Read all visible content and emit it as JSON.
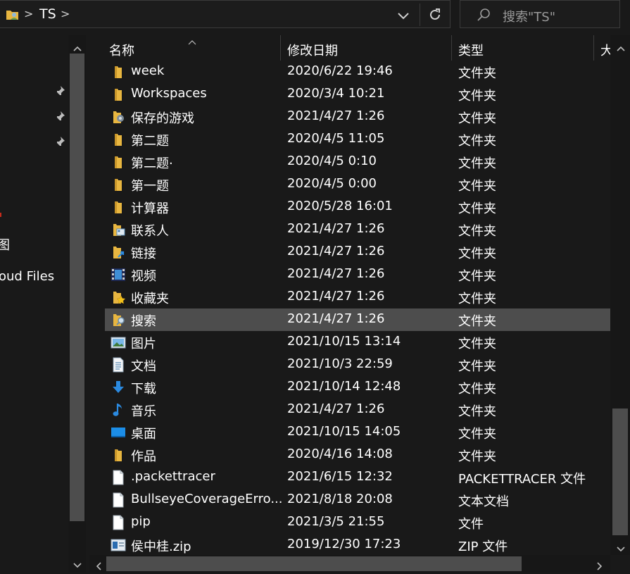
{
  "address": {
    "crumb": "TS",
    "separator": ">"
  },
  "search": {
    "placeholder": "搜索\"TS\""
  },
  "nav": {
    "items": [
      "图",
      "oud Files"
    ]
  },
  "columns": {
    "name": "名称",
    "date": "修改日期",
    "type": "类型",
    "size": "大"
  },
  "files": [
    {
      "name": "week",
      "date": "2020/6/22 19:46",
      "type": "文件夹",
      "icon": "folder-icon"
    },
    {
      "name": "Workspaces",
      "date": "2020/3/4 10:21",
      "type": "文件夹",
      "icon": "folder-icon"
    },
    {
      "name": "保存的游戏",
      "date": "2021/4/27 1:26",
      "type": "文件夹",
      "icon": "saved-games-icon"
    },
    {
      "name": "第二题",
      "date": "2020/4/5 11:05",
      "type": "文件夹",
      "icon": "folder-icon"
    },
    {
      "name": "第二题·",
      "date": "2020/4/5 0:10",
      "type": "文件夹",
      "icon": "folder-icon"
    },
    {
      "name": "第一题",
      "date": "2020/4/5 0:00",
      "type": "文件夹",
      "icon": "folder-icon"
    },
    {
      "name": "计算器",
      "date": "2020/5/28 16:01",
      "type": "文件夹",
      "icon": "folder-icon"
    },
    {
      "name": "联系人",
      "date": "2021/4/27 1:26",
      "type": "文件夹",
      "icon": "contacts-icon"
    },
    {
      "name": "链接",
      "date": "2021/4/27 1:26",
      "type": "文件夹",
      "icon": "links-icon"
    },
    {
      "name": "视频",
      "date": "2021/4/27 1:26",
      "type": "文件夹",
      "icon": "videos-icon"
    },
    {
      "name": "收藏夹",
      "date": "2021/4/27 1:26",
      "type": "文件夹",
      "icon": "favorites-icon"
    },
    {
      "name": "搜索",
      "date": "2021/4/27 1:26",
      "type": "文件夹",
      "icon": "searches-icon"
    },
    {
      "name": "图片",
      "date": "2021/10/15 13:14",
      "type": "文件夹",
      "icon": "pictures-icon"
    },
    {
      "name": "文档",
      "date": "2021/10/3 22:59",
      "type": "文件夹",
      "icon": "documents-icon"
    },
    {
      "name": "下载",
      "date": "2021/10/14 12:48",
      "type": "文件夹",
      "icon": "downloads-icon"
    },
    {
      "name": "音乐",
      "date": "2021/4/27 1:26",
      "type": "文件夹",
      "icon": "music-icon"
    },
    {
      "name": "桌面",
      "date": "2021/10/15 14:05",
      "type": "文件夹",
      "icon": "desktop-icon"
    },
    {
      "name": "作品",
      "date": "2020/4/16 14:08",
      "type": "文件夹",
      "icon": "folder-icon"
    },
    {
      "name": ".packettracer",
      "date": "2021/6/15 12:32",
      "type": "PACKETTRACER 文件",
      "icon": "file-icon"
    },
    {
      "name": "BullseyeCoverageErro...",
      "date": "2021/8/18 20:08",
      "type": "文本文档",
      "icon": "file-icon"
    },
    {
      "name": "pip",
      "date": "2021/3/5 21:55",
      "type": "文件",
      "icon": "file-icon"
    },
    {
      "name": "侯中桂.zip",
      "date": "2019/12/30 17:23",
      "type": "ZIP 文件",
      "icon": "zip-icon"
    }
  ],
  "selected_index": 11,
  "colors": {
    "background": "#191919",
    "selected": "#4d4d4d",
    "folder": "#e8b640",
    "accent": "#2b8ae0"
  }
}
